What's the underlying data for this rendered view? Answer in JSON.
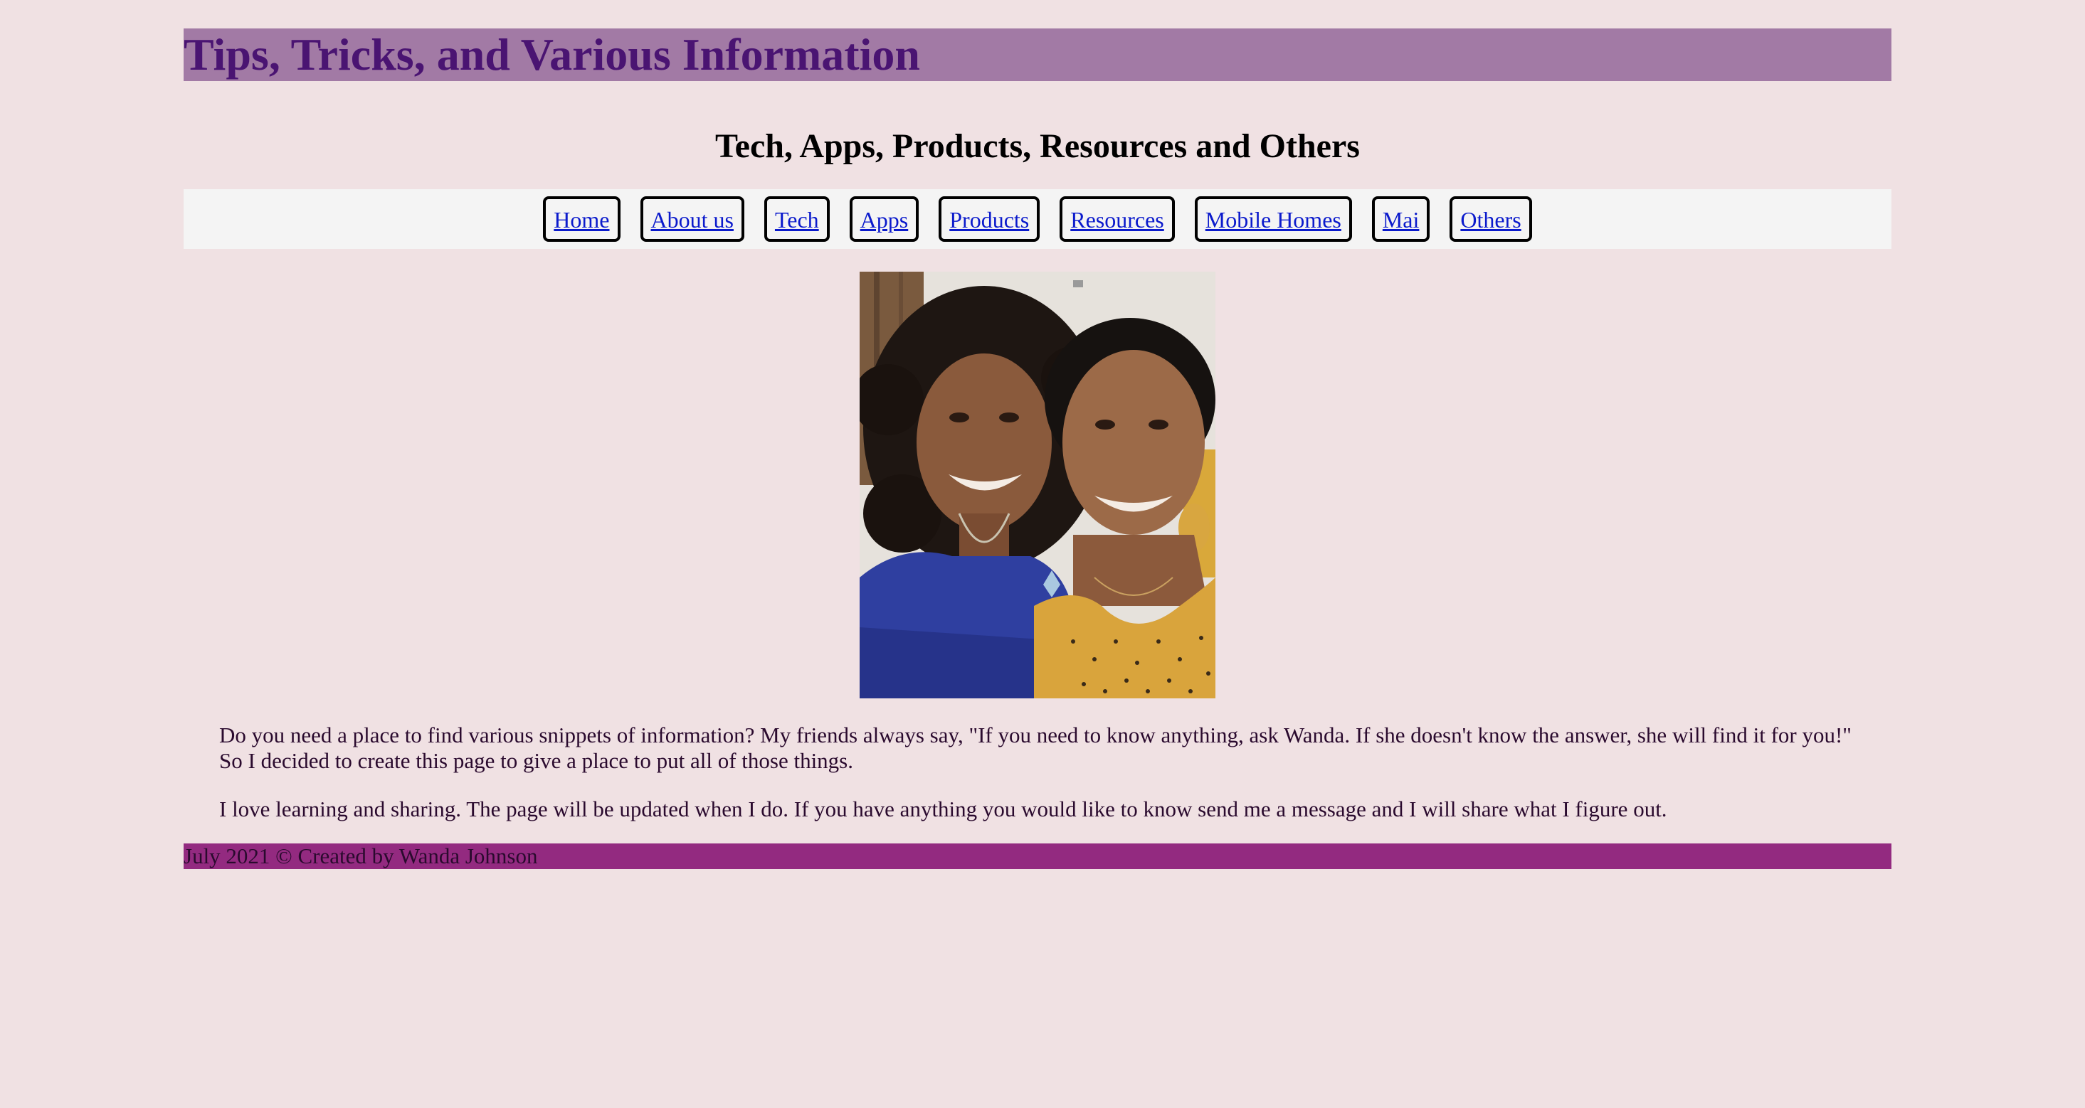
{
  "header": {
    "title": "Tips, Tricks, and Various Information",
    "subtitle": "Tech, Apps, Products, Resources and Others"
  },
  "nav": {
    "items": [
      {
        "label": "Home"
      },
      {
        "label": "About us"
      },
      {
        "label": "Tech"
      },
      {
        "label": "Apps"
      },
      {
        "label": "Products"
      },
      {
        "label": "Resources"
      },
      {
        "label": "Mobile Homes"
      },
      {
        "label": "Mai"
      },
      {
        "label": "Others"
      }
    ]
  },
  "main": {
    "paragraphs": [
      "Do you need a place to find various snippets of information? My friends always say, \"If you need to know anything, ask Wanda. If she doesn't know the answer, she will find it for you!\" So I decided to create this page to give a place to put all of those things.",
      "I love learning and sharing. The page will be updated when I do. If you have anything you would like to know send me a message and I will share what I figure out."
    ]
  },
  "footer": {
    "text": "July 2021 © Created by Wanda Johnson"
  },
  "colors": {
    "page_background": "#f0e1e3",
    "title_bar": "#a27aa5",
    "title_text": "#4a1472",
    "nav_background": "#f4f4f4",
    "link": "#0b1acc",
    "footer_bar": "#932a80"
  }
}
